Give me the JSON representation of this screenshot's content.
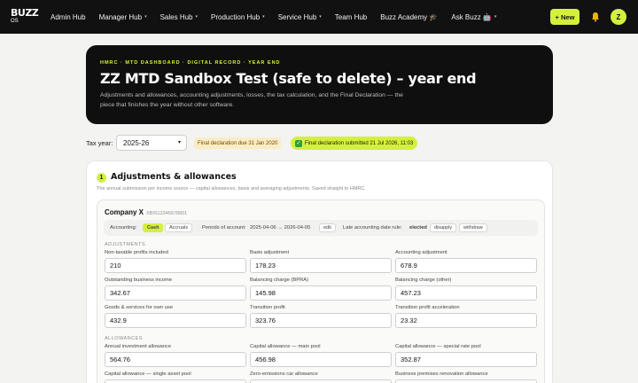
{
  "brand": {
    "line1": "BUZZ",
    "line2": "OS"
  },
  "nav": {
    "items": [
      {
        "label": "Admin Hub",
        "dropdown": false
      },
      {
        "label": "Manager Hub",
        "dropdown": true
      },
      {
        "label": "Sales Hub",
        "dropdown": true
      },
      {
        "label": "Production Hub",
        "dropdown": true
      },
      {
        "label": "Service Hub",
        "dropdown": true
      },
      {
        "label": "Team Hub",
        "dropdown": false
      },
      {
        "label": "Buzz Academy 🎓",
        "dropdown": false
      },
      {
        "label": "Ask Buzz 🤖",
        "dropdown": true
      }
    ],
    "new_label": "+ New",
    "avatar_initial": "Z",
    "caret": "▾"
  },
  "hero": {
    "kicker": "HMRC · MTD DASHBOARD · DIGITAL RECORD · YEAR END",
    "title": "ZZ MTD Sandbox Test (safe to delete) – year end",
    "description": "Adjustments and allowances, accounting adjustments, losses, the tax calculation, and the Final Declaration — the piece that finishes the year without other software."
  },
  "tax_year": {
    "label": "Tax year:",
    "selected": "2025-26",
    "due_badge": "Final declaration due 31 Jan 2020",
    "submitted_badge": "Final declaration submitted 21 Jul 2026, 11:03",
    "check": "✓"
  },
  "section": {
    "number": "1",
    "title": "Adjustments & allowances",
    "description": "The annual submission per income source — capital allowances, basis and averaging adjustments. Saved straight to HMRC."
  },
  "company": {
    "name": "Company X",
    "utr": "XBIS12345678901",
    "accounting_label": "Accounting:",
    "accounting_options": [
      "Cash",
      "Accruals"
    ],
    "periods_label": "Periods of account:",
    "periods_value": "2025-04-06 → 2026-04-05",
    "edit_label": "edit",
    "late_rule_label": "Late accounting date rule:",
    "late_rule_value": "elected",
    "disapply_label": "disapply",
    "withdraw_label": "withdraw"
  },
  "adjustments": {
    "group_label": "ADJUSTMENTS",
    "fields": [
      {
        "label": "Non-taxable profits included",
        "value": "210"
      },
      {
        "label": "Basis adjustment",
        "value": "178.23"
      },
      {
        "label": "Accounting adjustment",
        "value": "678.9"
      },
      {
        "label": "Outstanding business income",
        "value": "342.67"
      },
      {
        "label": "Balancing charge (BPRA)",
        "value": "145.98"
      },
      {
        "label": "Balancing charge (other)",
        "value": "457.23"
      },
      {
        "label": "Goods & services for own use",
        "value": "432.9"
      },
      {
        "label": "Transition profit",
        "value": "323.76"
      },
      {
        "label": "Transition profit acceleration",
        "value": "23.32"
      }
    ]
  },
  "allowances": {
    "group_label": "ALLOWANCES",
    "fields": [
      {
        "label": "Annual investment allowance",
        "value": "564.76"
      },
      {
        "label": "Capital allowance — main pool",
        "value": "456.98"
      },
      {
        "label": "Capital allowance — special rate pool",
        "value": "352.87"
      },
      {
        "label": "Capital allowance — single asset pool",
        "value": ""
      },
      {
        "label": "Zero-emissions car allowance",
        "value": ""
      },
      {
        "label": "Business premises renovation allowance",
        "value": ""
      }
    ]
  },
  "colors": {
    "accent": "#d4f03c",
    "nav_bg": "#111111",
    "hero_bg": "#0f0f0f"
  }
}
